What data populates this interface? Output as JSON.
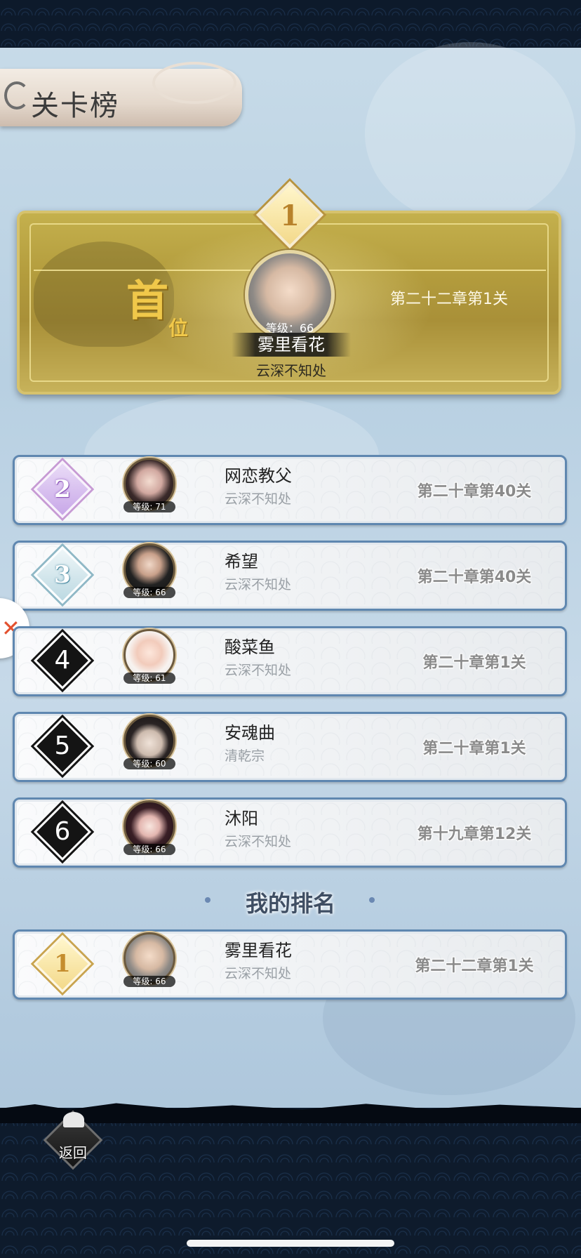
{
  "page": {
    "title": "关卡榜"
  },
  "champion": {
    "rank": "1",
    "badge_big": "首",
    "badge_small": "位",
    "level_label": "等级：66",
    "name": "雾里看花",
    "guild": "云深不知处",
    "stage": "第二十二章第1关"
  },
  "rows": [
    {
      "rank": "2",
      "rank_style": "purple",
      "level": "等级: 71",
      "name": "网恋教父",
      "guild": "云深不知处",
      "stage": "第二十章第40关"
    },
    {
      "rank": "3",
      "rank_style": "teal",
      "level": "等级: 66",
      "name": "希望",
      "guild": "云深不知处",
      "stage": "第二十章第40关"
    },
    {
      "rank": "4",
      "rank_style": "black",
      "level": "等级: 61",
      "name": "酸菜鱼",
      "guild": "云深不知处",
      "stage": "第二十章第1关"
    },
    {
      "rank": "5",
      "rank_style": "black",
      "level": "等级: 60",
      "name": "安魂曲",
      "guild": "清乾宗",
      "stage": "第二十章第1关"
    },
    {
      "rank": "6",
      "rank_style": "black",
      "level": "等级: 66",
      "name": "沐阳",
      "guild": "云深不知处",
      "stage": "第十九章第12关"
    }
  ],
  "my_rank": {
    "title": "我的排名",
    "rank": "1",
    "level": "等级: 66",
    "name": "雾里看花",
    "guild": "云深不知处",
    "stage": "第二十二章第1关"
  },
  "footer": {
    "back_label": "返回"
  },
  "icons": {
    "side_fab": "close-x-icon",
    "back": "back-crest-icon",
    "title_swirl": "cloud-swirl-icon"
  },
  "colors": {
    "row_border": "#5f87b0",
    "champ_gold": "#b39c3d",
    "stage_text": "#8a8a8a"
  }
}
